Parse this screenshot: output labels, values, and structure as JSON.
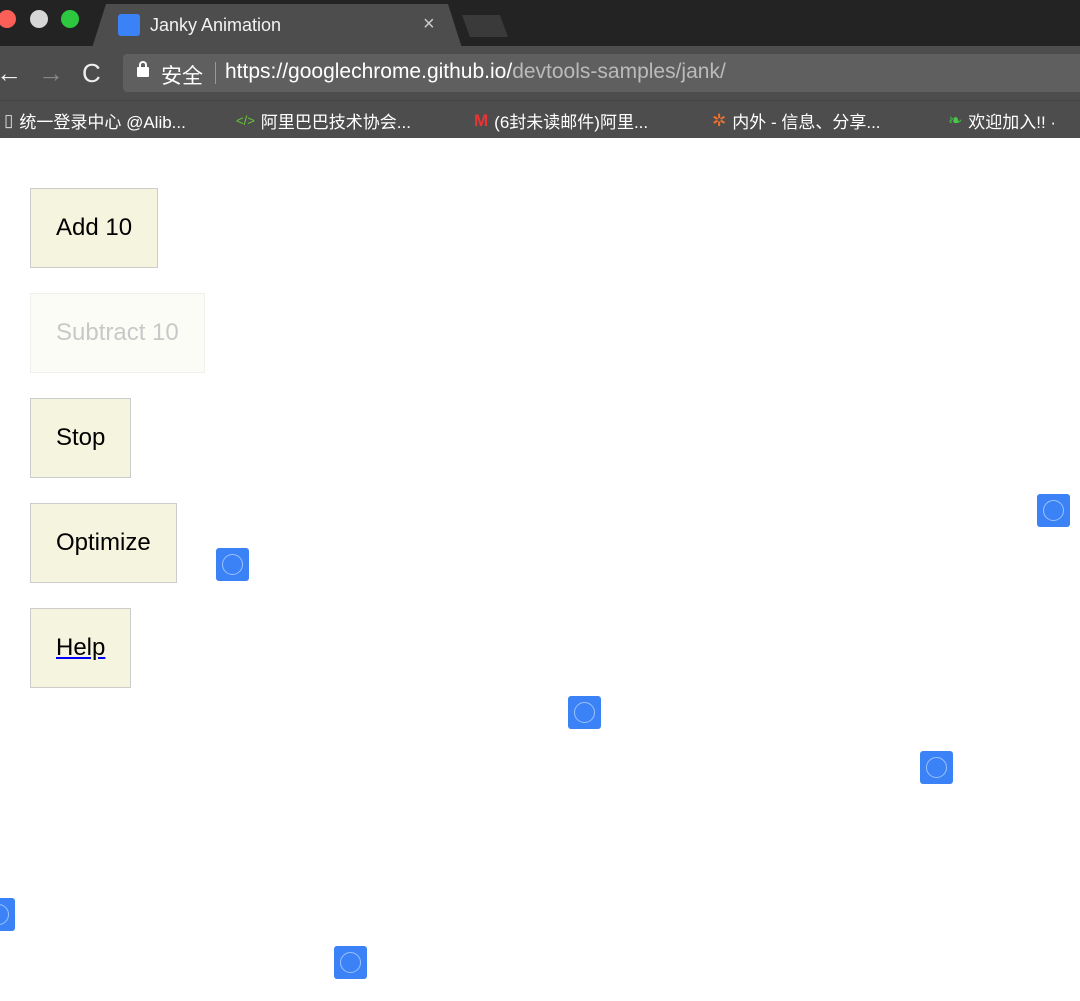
{
  "browser": {
    "tab_title": "Janky Animation",
    "close": "×",
    "secure_label": "安全",
    "url_host": "https://googlechrome.github.io/",
    "url_path": "devtools-samples/jank/",
    "back": "←",
    "forward": "→",
    "reload": "C",
    "bookmarks": [
      {
        "icon": "📄",
        "label": "统一登录中心 @Alib..."
      },
      {
        "icon": "</>",
        "label": "阿里巴巴技术协会..."
      },
      {
        "icon": "M",
        "label": "(6封未读邮件)阿里..."
      },
      {
        "icon": "✲",
        "label": "内外 - 信息、分享..."
      },
      {
        "icon": "❧",
        "label": "欢迎加入!! ·"
      }
    ]
  },
  "page": {
    "buttons": {
      "add": "Add 10",
      "subtract": "Subtract 10",
      "stop": "Stop",
      "optimize": "Optimize",
      "help": "Help"
    }
  },
  "colors": {
    "mover": "#3b82f6",
    "button_bg": "#f5f4de"
  }
}
